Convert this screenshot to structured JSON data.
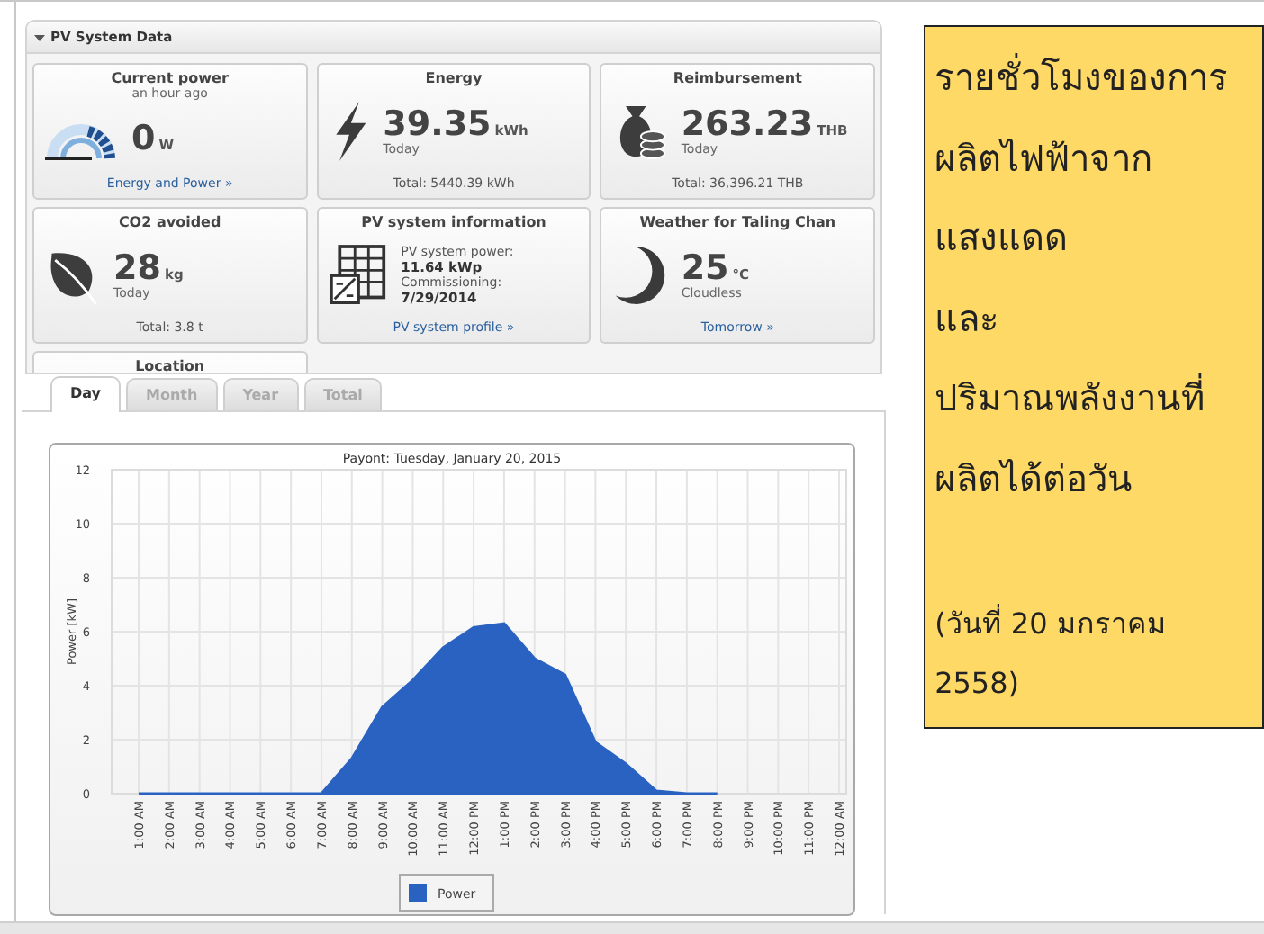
{
  "panel": {
    "title": "PV System Data",
    "expanded": true
  },
  "cards": [
    {
      "kind": "power",
      "title": "Current power",
      "subtitle": "an hour ago",
      "value": "0",
      "unit": "W",
      "footer": {
        "kind": "link",
        "text": "Energy and Power »"
      }
    },
    {
      "kind": "energy",
      "title": "Energy",
      "value": "39.35",
      "unit": "kWh",
      "period": "Today",
      "footer": {
        "kind": "total",
        "text": "Total: 5440.39 kWh"
      }
    },
    {
      "kind": "reimbursement",
      "title": "Reimbursement",
      "value": "263.23",
      "unit": "THB",
      "period": "Today",
      "footer": {
        "kind": "total",
        "text": "Total: 36,396.21 THB"
      }
    },
    {
      "kind": "co2",
      "title": "CO2 avoided",
      "value": "28",
      "unit": "kg",
      "period": "Today",
      "footer": {
        "kind": "total",
        "text": "Total: 3.8 t"
      }
    },
    {
      "kind": "system",
      "title": "PV system information",
      "lines": [
        {
          "text": "PV system power:",
          "bold": false
        },
        {
          "text": "11.64 kWp",
          "bold": true
        },
        {
          "text": "Commissioning:",
          "bold": false
        },
        {
          "text": "7/29/2014",
          "bold": true
        }
      ],
      "footer": {
        "kind": "link",
        "text": "PV system profile »"
      }
    },
    {
      "kind": "weather",
      "title": "Weather for Taling Chan",
      "value": "25",
      "unit": "°C",
      "period": "Cloudless",
      "footer": {
        "kind": "link",
        "text": "Tomorrow »"
      }
    },
    {
      "kind": "location",
      "title": "Location"
    }
  ],
  "chart_panel": {
    "tabs": [
      {
        "label": "Day",
        "selected": true
      },
      {
        "label": "Month",
        "selected": false
      },
      {
        "label": "Year",
        "selected": false
      },
      {
        "label": "Total",
        "selected": false
      }
    ],
    "chart_data": {
      "type": "area",
      "title": "Payont: Tuesday, January 20, 2015",
      "ylabel": "Power [kW]",
      "categories": [
        "1:00 AM",
        "2:00 AM",
        "3:00 AM",
        "4:00 AM",
        "5:00 AM",
        "6:00 AM",
        "7:00 AM",
        "8:00 AM",
        "9:00 AM",
        "10:00 AM",
        "11:00 AM",
        "12:00 PM",
        "1:00 PM",
        "2:00 PM",
        "3:00 PM",
        "4:00 PM",
        "5:00 PM",
        "6:00 PM",
        "7:00 PM",
        "8:00 PM",
        "9:00 PM",
        "10:00 PM",
        "11:00 PM",
        "12:00 AM"
      ],
      "series": [
        {
          "name": "Power",
          "color": "#2a62c2",
          "values": [
            0,
            0,
            0,
            0,
            0,
            0,
            0,
            1.3,
            3.2,
            4.2,
            5.4,
            6.15,
            6.3,
            5.0,
            4.4,
            1.9,
            1.1,
            0.1,
            0,
            0,
            null,
            null,
            null,
            null
          ]
        }
      ],
      "grid": true,
      "ylim": [
        0,
        12
      ],
      "yticks": [
        0,
        2,
        4,
        6,
        8,
        10,
        12
      ]
    }
  },
  "note": {
    "lines": [
      "รายชั่วโมงของการ",
      "ผลิตไฟฟ้าจาก",
      "แสงแดด",
      "และ",
      "ปริมาณพลังงานที่",
      "ผลิตได้ต่อวัน"
    ],
    "date": "(วันที่ 20 มกราคม 2558)"
  }
}
